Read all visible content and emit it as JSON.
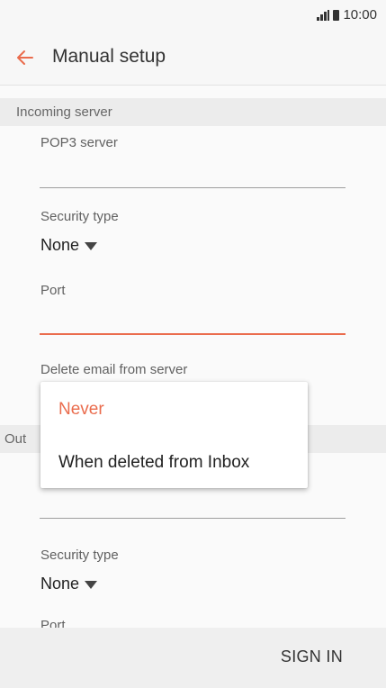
{
  "status_bar": {
    "time": "10:00"
  },
  "appbar": {
    "title": "Manual setup"
  },
  "incoming": {
    "header": "Incoming server",
    "server_label": "POP3 server",
    "security_label": "Security type",
    "security_value": "None",
    "port_label": "Port",
    "delete_label": "Delete email from server"
  },
  "outgoing": {
    "header_partial": "Out",
    "security_label": "Security type",
    "security_value": "None",
    "port_label_partial": "Port"
  },
  "delete_menu": {
    "options": [
      "Never",
      "When deleted from Inbox"
    ],
    "selected_index": 0
  },
  "footer": {
    "sign_in_label": "SIGN IN"
  },
  "colors": {
    "accent": "#ea6c4d",
    "text": "#222222",
    "secondary_text": "#616161"
  }
}
